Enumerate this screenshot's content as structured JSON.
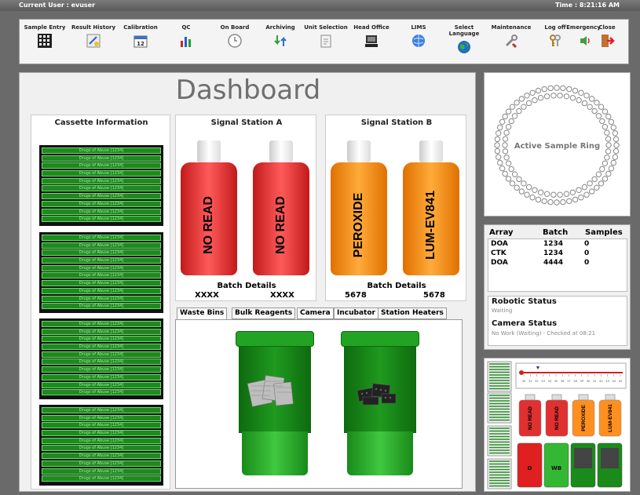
{
  "header": {
    "user_label": "Current User : evuser",
    "time_label": "Time : 8:21:16 AM"
  },
  "toolbar": {
    "items": [
      {
        "label": "Sample Entry",
        "icon": "grid-icon"
      },
      {
        "label": "Result History",
        "icon": "history-icon"
      },
      {
        "label": "Calibration",
        "icon": "calendar-icon"
      },
      {
        "label": "QC",
        "icon": "bar-chart-icon"
      },
      {
        "label": "On Board",
        "icon": "clock-icon"
      },
      {
        "label": "Archiving",
        "icon": "archive-icon"
      },
      {
        "label": "Unit Selection",
        "icon": "unit-icon"
      },
      {
        "label": "Head Office",
        "icon": "computer-icon"
      },
      {
        "label": "LIMS",
        "icon": "globe-icon"
      },
      {
        "label": "Select Language",
        "icon": "earth-icon"
      },
      {
        "label": "Maintenance",
        "icon": "wrench-icon"
      },
      {
        "label": "Log off",
        "icon": "keys-icon"
      },
      {
        "label": "Emergency",
        "icon": "siren-icon"
      },
      {
        "label": "Close",
        "icon": "door-exit-icon"
      }
    ]
  },
  "dashboard": {
    "title": "Dashboard",
    "cassette": {
      "title": "Cassette Information",
      "row_label": "Drugs of Abuse [1234]"
    },
    "station_a": {
      "title": "Signal Station A",
      "bottles": [
        "NO READ",
        "NO READ"
      ],
      "batch_title": "Batch Details",
      "batch_values": [
        "XXXX",
        "XXXX"
      ]
    },
    "station_b": {
      "title": "Signal Station B",
      "bottles": [
        "PEROXIDE",
        "LUM-EV841"
      ],
      "batch_title": "Batch Details",
      "batch_values": [
        "5678",
        "5678"
      ]
    },
    "tabs": [
      "Waste Bins",
      "Bulk Reagents",
      "Camera",
      "Incubator",
      "Station Heaters"
    ]
  },
  "ring": {
    "label": "Active Sample Ring"
  },
  "array_table": {
    "headers": [
      "Array",
      "Batch",
      "Samples"
    ],
    "rows": [
      [
        "DOA",
        "1234",
        "0"
      ],
      [
        "CTK",
        "1234",
        "0"
      ],
      [
        "DOA",
        "4444",
        "0"
      ]
    ]
  },
  "status": {
    "robotic_title": "Robotic Status",
    "robotic_value": "Waiting",
    "camera_title": "Camera Status",
    "camera_value": "No Work (Waiting) - Checked at 08:21"
  },
  "mini": {
    "scale_labels": [
      "30",
      "31",
      "32",
      "33",
      "34",
      "35",
      "36",
      "37",
      "38",
      "39",
      "40",
      "41",
      "42",
      "43",
      "44",
      "45"
    ],
    "bottles": [
      "NO READ",
      "NO READ",
      "PEROXIDE",
      "LUM-EV841"
    ],
    "bins": [
      "D",
      "WB"
    ]
  },
  "colors": {
    "cassette_row": "#1e8a1e",
    "bottle_red": "#e03030",
    "bottle_orange": "#ff9020",
    "bin_green": "#23a323"
  }
}
